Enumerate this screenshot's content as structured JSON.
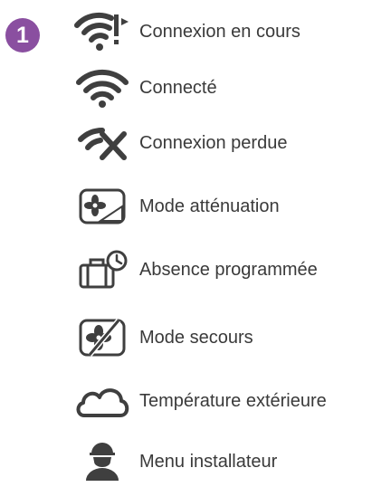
{
  "badge": {
    "number": "1",
    "color": "#8a4fa0"
  },
  "icon_color": "#3f3f3f",
  "text_color": "#3a3a3a",
  "items": [
    {
      "icon": "wifi-connecting-icon",
      "label": "Connexion en cours"
    },
    {
      "icon": "wifi-icon",
      "label": "Connecté"
    },
    {
      "icon": "wifi-lost-icon",
      "label": "Connexion perdue"
    },
    {
      "icon": "fan-attenuation-icon",
      "label": "Mode atténuation"
    },
    {
      "icon": "suitcase-clock-icon",
      "label": "Absence programmée"
    },
    {
      "icon": "fan-backup-icon",
      "label": "Mode secours"
    },
    {
      "icon": "cloud-icon",
      "label": "Température extérieure"
    },
    {
      "icon": "installer-icon",
      "label": "Menu installateur"
    }
  ]
}
